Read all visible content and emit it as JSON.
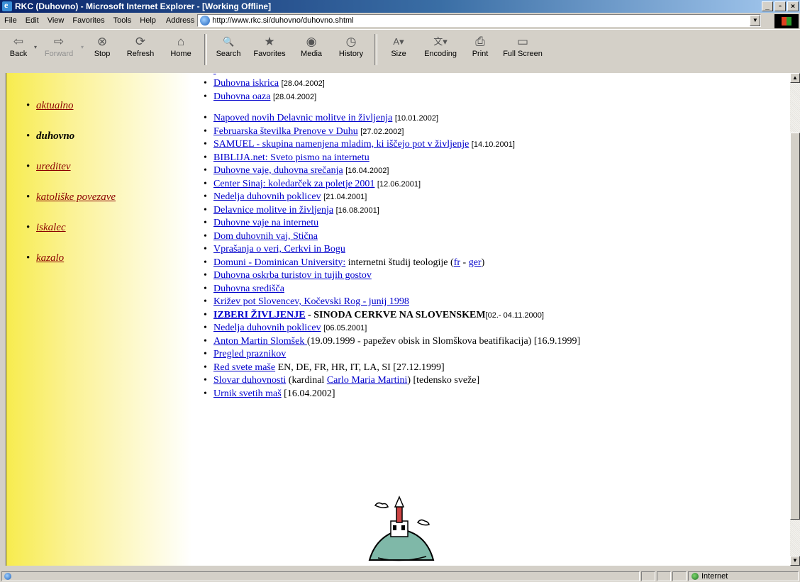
{
  "window": {
    "title": "RKC (Duhovno) - Microsoft Internet Explorer - [Working Offline]",
    "controls": [
      "_",
      "▫",
      "×"
    ]
  },
  "menu": [
    "File",
    "Edit",
    "View",
    "Favorites",
    "Tools",
    "Help"
  ],
  "address": {
    "label": "Address",
    "url": "http://www.rkc.si/duhovno/duhovno.shtml"
  },
  "toolbar": [
    {
      "label": "Back",
      "icon": "back-arrow-icon",
      "glyph": "⇦"
    },
    {
      "label": "Forward",
      "icon": "forward-arrow-icon",
      "glyph": "⇨"
    },
    {
      "label": "Stop",
      "icon": "stop-icon",
      "glyph": "⊗"
    },
    {
      "label": "Refresh",
      "icon": "refresh-icon",
      "glyph": "⟳"
    },
    {
      "label": "Home",
      "icon": "home-icon",
      "glyph": "⌂"
    },
    {
      "label": "Search",
      "icon": "search-icon",
      "glyph": "🔍"
    },
    {
      "label": "Favorites",
      "icon": "favorites-icon",
      "glyph": "★"
    },
    {
      "label": "Media",
      "icon": "media-icon",
      "glyph": "◉"
    },
    {
      "label": "History",
      "icon": "history-icon",
      "glyph": "◷"
    },
    {
      "label": "Size",
      "icon": "text-size-icon",
      "glyph": "A▾"
    },
    {
      "label": "Encoding",
      "icon": "encoding-icon",
      "glyph": "文▾"
    },
    {
      "label": "Print",
      "icon": "print-icon",
      "glyph": "⎙"
    },
    {
      "label": "Full Screen",
      "icon": "full-screen-icon",
      "glyph": "▭"
    }
  ],
  "sidebar": {
    "items": [
      {
        "label": "aktualno",
        "current": false
      },
      {
        "label": "duhovno",
        "current": true
      },
      {
        "label": "ureditev",
        "current": false
      },
      {
        "label": "katoliške povezave",
        "current": false
      },
      {
        "label": "iskalec",
        "current": false
      },
      {
        "label": "kazalo",
        "current": false
      }
    ]
  },
  "links": {
    "l1": "Duhovna iskrica",
    "d1": "[28.04.2002]",
    "l2": "Duhovna oaza",
    "d2": "[28.04.2002]",
    "l3": "Napoved novih Delavnic molitve in življenja",
    "d3": "[10.01.2002]",
    "l4": "Februarska številka Prenove v Duhu",
    "d4": "[27.02.2002]",
    "l5": "SAMUEL - skupina namenjena mladim, ki iščejo pot v življenje",
    "d5": "[14.10.2001]",
    "l6": "BIBLIJA.net: Sveto pismo na internetu",
    "l7": "Duhovne vaje, duhovna srečanja",
    "d7": "[16.04.2002]",
    "l8": "Center Sinaj: koledarček za poletje 2001",
    "d8": "[12.06.2001]",
    "l9": "Nedelja duhovnih poklicev",
    "d9": "[21.04.2001]",
    "l10": "Delavnice molitve in življenja",
    "d10": "[16.08.2001]",
    "l11": "Duhovne vaje na internetu",
    "l12": "Dom duhovnih vaj, Stična",
    "l13": "Vprašanja o veri, Cerkvi in Bogu",
    "l14": "Domuni - Dominican University:",
    "t14": " internetni študij teologije (",
    "l14fr": "fr",
    "t14b": " - ",
    "l14ger": "ger",
    "t14c": ")",
    "l15": "Duhovna oskrba turistov in tujih gostov",
    "l16": "Duhovna središča",
    "l17": "Križev pot Slovencev, Kočevski Rog - junij 1998",
    "l18": "IZBERI ŽIVLJENJE",
    "t18": " - SINODA CERKVE NA SLOVENSKEM ",
    "d18": "[02.- 04.11.2000]",
    "l19": "Nedelja duhovnih poklicev",
    "d19": "[06.05.2001]",
    "l20": "Anton Martin Slomšek ",
    "t20": "(19.09.1999 - papežev obisk in Slomškova beatifikacija) [16.9.1999]",
    "l21": "Pregled praznikov",
    "l22": "Red svete maše",
    "t22": " EN, DE, FR, HR, IT, LA, SI [27.12.1999]",
    "l23": "Slovar duhovnosti",
    "t23": " (kardinal ",
    "l23b": "Carlo Maria Martini",
    "t23b": ") [tedensko sveže]",
    "l24": "Urnik svetih maš",
    "t24": " [16.04.2002]"
  },
  "status": {
    "zone": "Internet"
  }
}
